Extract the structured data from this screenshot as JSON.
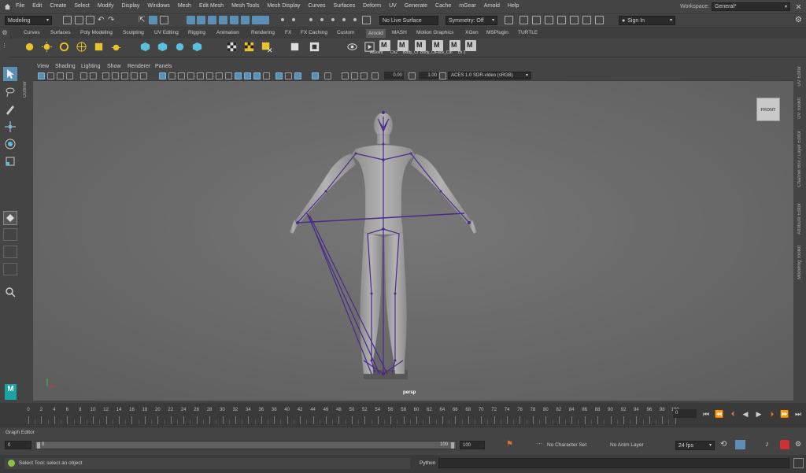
{
  "menubar": {
    "items": [
      "File",
      "Edit",
      "Create",
      "Select",
      "Modify",
      "Display",
      "Windows",
      "Mesh",
      "Edit Mesh",
      "Mesh Tools",
      "Mesh Display",
      "Curves",
      "Surfaces",
      "Deform",
      "UV",
      "Generate",
      "Cache",
      "mGear",
      "Arnold",
      "Help"
    ],
    "workspace_label": "Workspace:",
    "workspace_value": "General*"
  },
  "statusline": {
    "mode": "Modeling",
    "live_surface": "No Live Surface",
    "symmetry": "Symmetry: Off",
    "sign_in": "Sign In"
  },
  "shelf": {
    "tabs": [
      "Curves",
      "Surfaces",
      "Poly Modeling",
      "Sculpting",
      "UV Editing",
      "Rigging",
      "Animation",
      "Rendering",
      "FX",
      "FX Caching",
      "Custom",
      "Arnold",
      "MASH",
      "Motion Graphics",
      "XGen",
      "MSPlugin",
      "TURTLE"
    ],
    "active_tab": "Arnold",
    "custom_buttons": [
      "AllJoint",
      "Ch2",
      "Body_Ct",
      "Body_Ct",
      "Face_Ctrl",
      "ch 2"
    ]
  },
  "panel": {
    "menus": [
      "View",
      "Shading",
      "Lighting",
      "Show",
      "Renderer",
      "Panels"
    ],
    "gamma": "0.00",
    "exposure": "1.00",
    "color_space": "ACES 1.0 SDR-video (sRGB)"
  },
  "viewport": {
    "camera": "persp",
    "viewcube": "FRONT"
  },
  "side_tabs": {
    "left": "Outliner",
    "right": [
      "UV Editor",
      "UV Toolkit",
      "Channel Box / Layer Editor",
      "Attribute Editor",
      "Modeling Toolkit"
    ]
  },
  "timeline": {
    "ticks": [
      "0",
      "2",
      "4",
      "6",
      "8",
      "10",
      "12",
      "14",
      "16",
      "18",
      "20",
      "22",
      "24",
      "26",
      "28",
      "30",
      "32",
      "34",
      "36",
      "38",
      "40",
      "42",
      "44",
      "46",
      "48",
      "50",
      "52",
      "54",
      "56",
      "58",
      "60",
      "62",
      "64",
      "66",
      "68",
      "70",
      "72",
      "74",
      "76",
      "78",
      "80",
      "82",
      "84",
      "86",
      "88",
      "90",
      "92",
      "94",
      "96",
      "98",
      "100"
    ],
    "current_frame": "0"
  },
  "graph_editor_label": "Graph Editor",
  "range": {
    "start": "0",
    "inner_start": "0",
    "inner_end": "100",
    "end": "100",
    "character_set": "No Character Set",
    "anim_layer": "No Anim Layer",
    "fps": "24 fps"
  },
  "help_line": "Select Tool: select an object",
  "command_lang": "Python",
  "colors": {
    "accent": "#5b8fb3",
    "viewport_bg": "#6b6b6b",
    "joint": "#4a2a8a",
    "logo": "#1aa3a3"
  }
}
